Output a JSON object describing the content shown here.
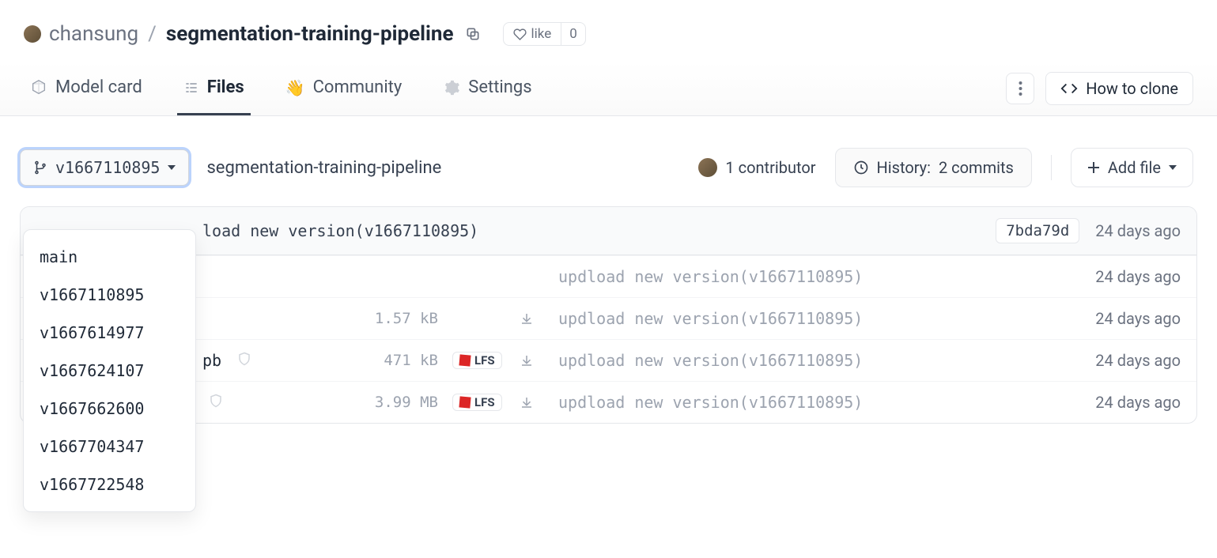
{
  "header": {
    "owner": "chansung",
    "repo": "segmentation-training-pipeline",
    "like_label": "like",
    "like_count": "0"
  },
  "tabs": {
    "model_card": "Model card",
    "files": "Files",
    "community": "Community",
    "settings": "Settings"
  },
  "actions": {
    "clone": "How to clone"
  },
  "branch": {
    "selected": "v1667110895",
    "options": [
      "main",
      "v1667110895",
      "v1667614977",
      "v1667624107",
      "v1667662600",
      "v1667704347",
      "v1667722548"
    ]
  },
  "breadcrumb": "segmentation-training-pipeline",
  "contributors": {
    "label": "1 contributor"
  },
  "history": {
    "prefix": "History:",
    "count": "2 commits"
  },
  "addfile": "Add file",
  "commit": {
    "message": "load new version(v1667110895)",
    "hash": "7bda79d",
    "time": "24 days ago"
  },
  "files": [
    {
      "name": "",
      "size": "",
      "lfs": false,
      "shield": false,
      "msg": "updload new version(v1667110895)",
      "time": "24 days ago"
    },
    {
      "name": "",
      "size": "1.57 kB",
      "lfs": false,
      "shield": false,
      "msg": "updload new version(v1667110895)",
      "time": "24 days ago"
    },
    {
      "name": "pb",
      "size": "471 kB",
      "lfs": true,
      "shield": true,
      "msg": "updload new version(v1667110895)",
      "time": "24 days ago"
    },
    {
      "name": "",
      "size": "3.99 MB",
      "lfs": true,
      "shield": true,
      "msg": "updload new version(v1667110895)",
      "time": "24 days ago"
    }
  ]
}
